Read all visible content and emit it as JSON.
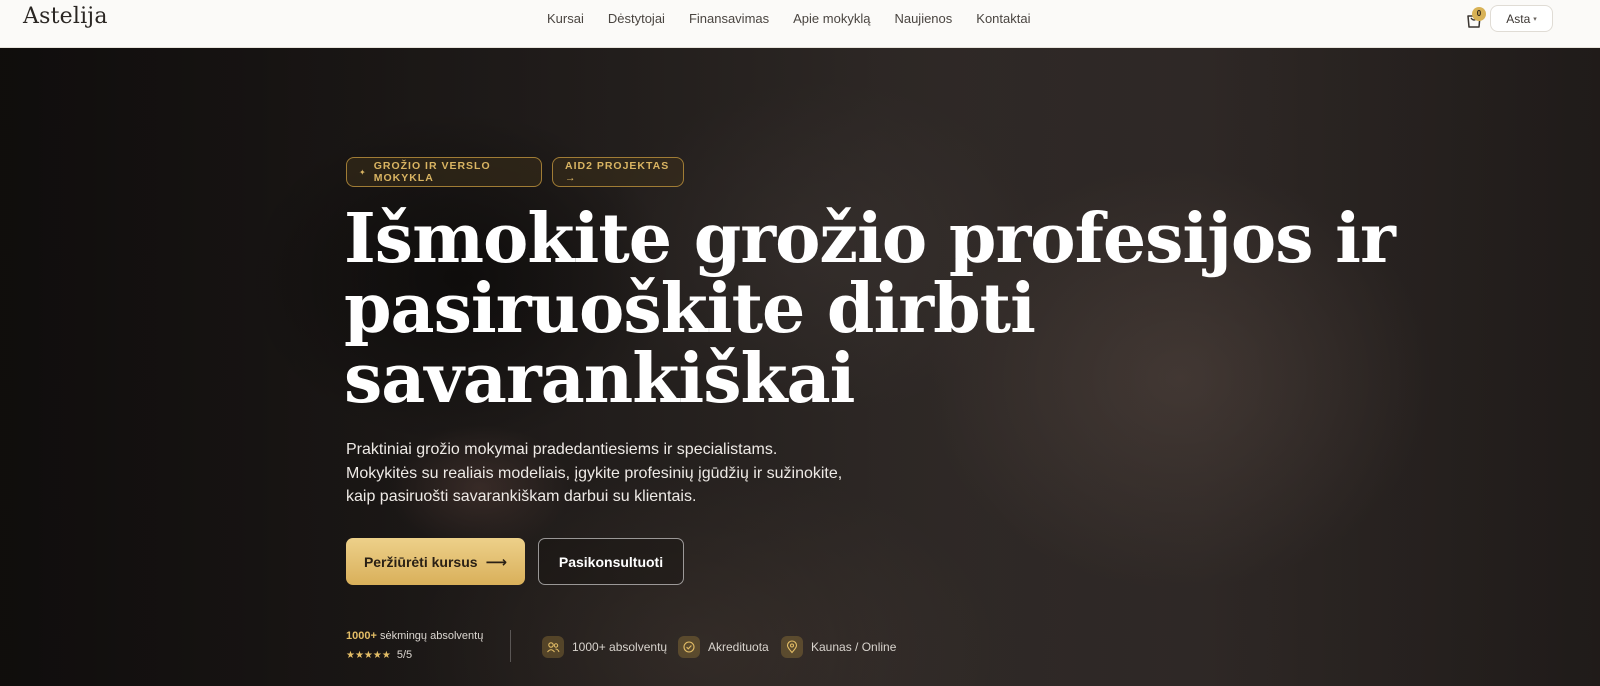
{
  "nav": {
    "logo": "Astelija",
    "menu": [
      "Kursai",
      "Dėstytojai",
      "Finansavimas",
      "Apie mokyklą",
      "Naujienos",
      "Kontaktai"
    ],
    "cart_count": "0",
    "user_label": "Asta",
    "user_caret": "▾"
  },
  "hero": {
    "pill_star": "✦",
    "pill_school": "GROŽIO IR VERSLO MOKYKLA",
    "pill_project": "AID2 PROJEKTAS →",
    "headline": [
      "Išmokite grožio profesijos ir",
      "pasiruoškite dirbti",
      "savarankiškai"
    ],
    "subtitle": [
      "Praktiniai grožio mokymai pradedantiesiems ir specialistams.",
      "Mokykitės su realiais modeliais, įgykite profesinių įgūdžių ir sužinokite,",
      "kaip pasiruošti savarankiškam darbui su klientais."
    ],
    "cta_primary": "Peržiūrėti kursus",
    "cta_primary_arrow": "⟶",
    "cta_secondary": "Pasikonsultuoti"
  },
  "stats": {
    "graduates_count": "1000+",
    "graduates_text": "sėkmingų absolventų",
    "stars": "★★★★★",
    "rating": "5/5",
    "badges": [
      {
        "icon": "users-icon",
        "label": "1000+ absolventų"
      },
      {
        "icon": "check-circle-icon",
        "label": "Akredituota"
      },
      {
        "icon": "location-pin-icon",
        "label": "Kaunas / Online"
      }
    ]
  },
  "colors": {
    "accent_gold": "#d9b05a",
    "nav_bg": "#fbfaf8",
    "hero_text": "#ffffff"
  }
}
